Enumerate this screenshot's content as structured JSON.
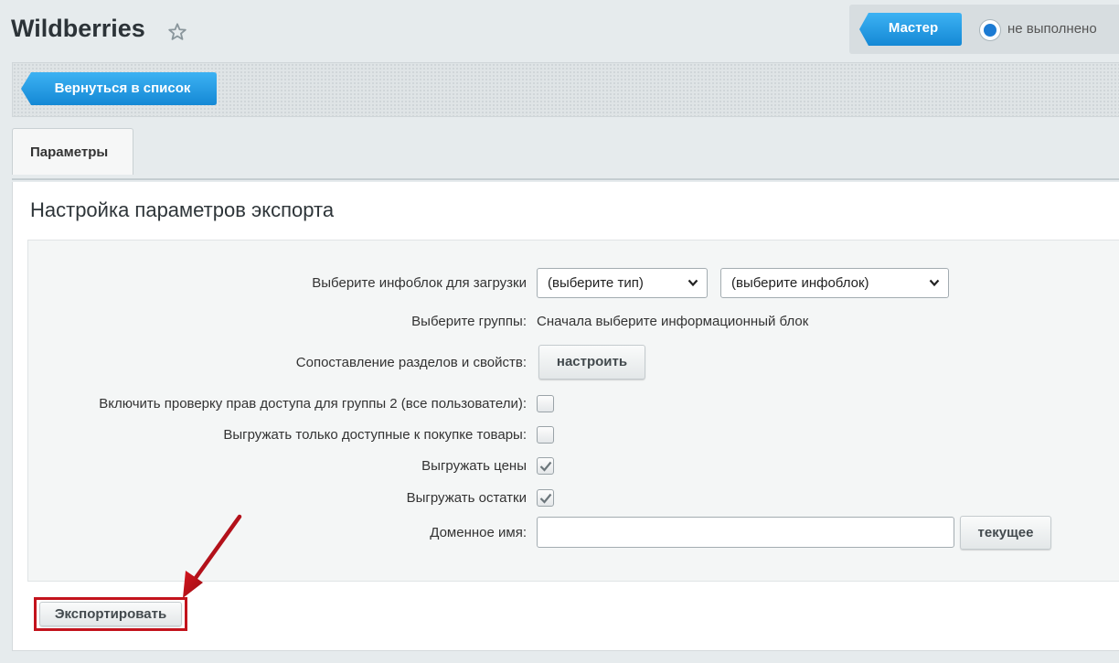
{
  "header": {
    "title": "Wildberries",
    "master_button": "Мастер",
    "status_label": "не выполнено"
  },
  "toolbar": {
    "back_button": "Вернуться в список"
  },
  "tabs": [
    {
      "label": "Параметры",
      "active": true
    }
  ],
  "section": {
    "title": "Настройка параметров экспорта"
  },
  "form": {
    "infoblock_label": "Выберите инфоблок для загрузки",
    "type_select_value": "(выберите тип)",
    "infoblock_select_value": "(выберите инфоблок)",
    "groups_label": "Выберите группы:",
    "groups_value": "Сначала выберите информационный блок",
    "mapping_label": "Сопоставление разделов и свойств:",
    "mapping_button": "настроить",
    "access_check_label": "Включить проверку прав доступа для группы 2 (все пользователи):",
    "access_check_checked": false,
    "only_available_label": "Выгружать только доступные к покупке товары:",
    "only_available_checked": false,
    "export_prices_label": "Выгружать цены",
    "export_prices_checked": true,
    "export_stock_label": "Выгружать остатки",
    "export_stock_checked": true,
    "domain_label": "Доменное имя:",
    "domain_value": "",
    "current_button": "текущее"
  },
  "actions": {
    "export_button": "Экспортировать"
  },
  "colors": {
    "accent_blue": "#1d9be6",
    "radio_blue": "#1c7bd3",
    "highlight_red": "#c3131c"
  }
}
